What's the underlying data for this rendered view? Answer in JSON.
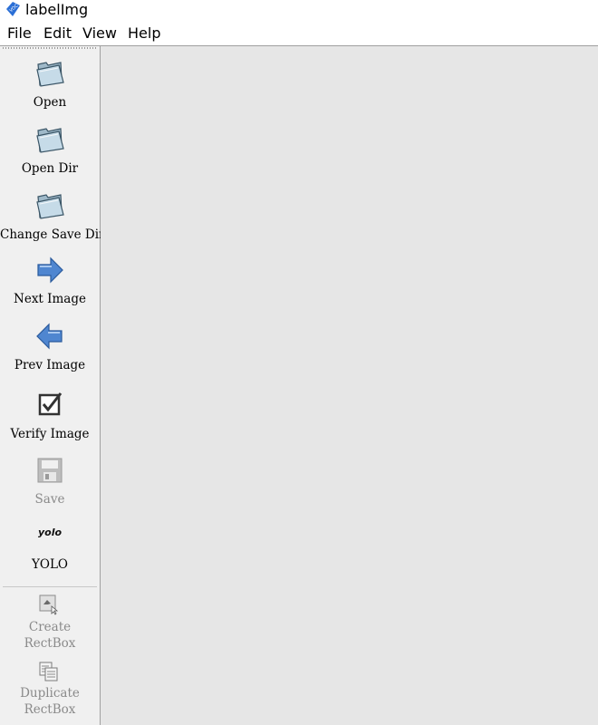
{
  "window": {
    "title": "labelImg",
    "icon": "labelimg-logo-icon"
  },
  "menu": {
    "items": [
      "File",
      "Edit",
      "View",
      "Help"
    ]
  },
  "toolbar": {
    "open": {
      "label": "Open",
      "icon": "folder-open-icon"
    },
    "open_dir": {
      "label": "Open Dir",
      "icon": "folder-open-icon"
    },
    "change_save_dir": {
      "label": "Change Save Dir",
      "icon": "folder-open-icon"
    },
    "next_image": {
      "label": "Next Image",
      "icon": "arrow-right-icon"
    },
    "prev_image": {
      "label": "Prev Image",
      "icon": "arrow-left-icon"
    },
    "verify_image": {
      "label": "Verify Image",
      "icon": "checkbox-icon"
    },
    "save": {
      "label": "Save",
      "icon": "floppy-disk-icon",
      "enabled": false
    },
    "format": {
      "label": "YOLO",
      "icon_text": "yolo"
    },
    "create_rectbox": {
      "label_line1": "Create",
      "label_line2": "RectBox",
      "icon": "create-rect-icon",
      "enabled": false
    },
    "duplicate_rectbox": {
      "label_line1": "Duplicate",
      "label_line2": "RectBox",
      "icon": "duplicate-icon",
      "enabled": false
    }
  },
  "colors": {
    "canvas_bg": "#e6e6e6",
    "toolbar_bg": "#f0f0f0",
    "accent_blue": "#2b6fd6",
    "disabled_text": "#8a8a8a"
  }
}
